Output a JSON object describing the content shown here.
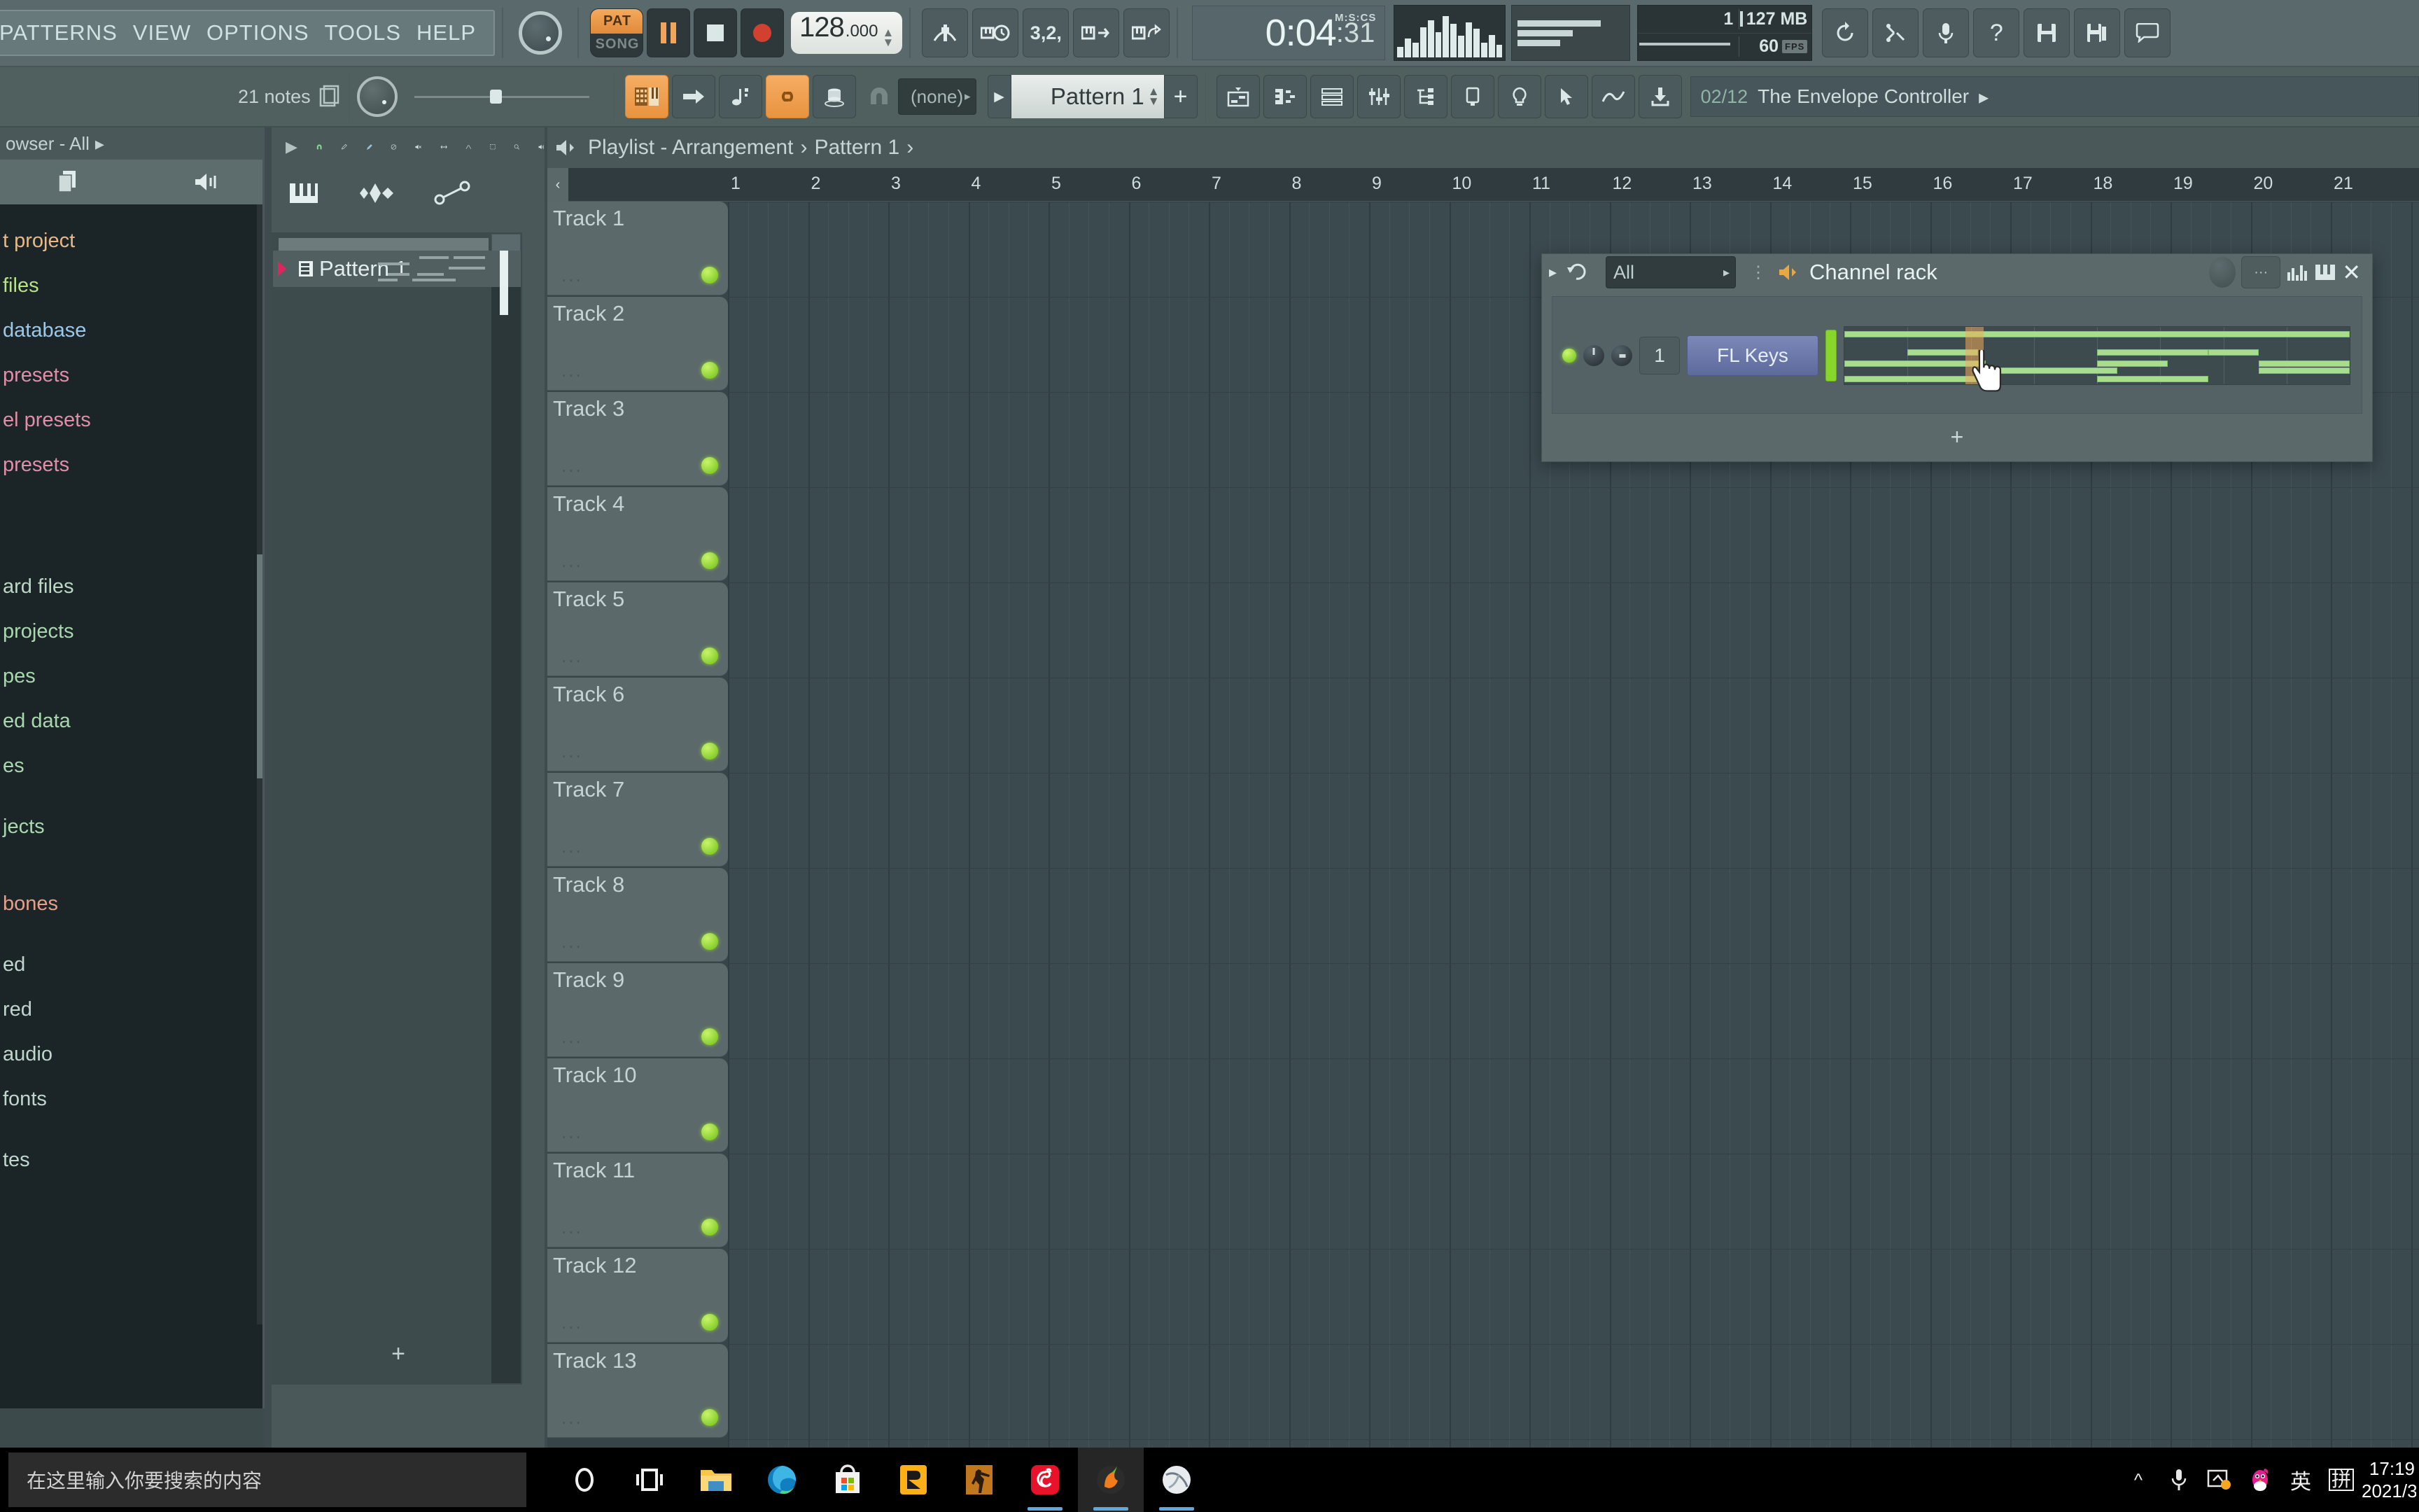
{
  "app": {
    "name": "FL Studio",
    "menu": [
      "PATTERNS",
      "VIEW",
      "OPTIONS",
      "TOOLS",
      "HELP"
    ]
  },
  "transport": {
    "pat_label": "PAT",
    "song_label": "SONG",
    "tempo_int": "128",
    "tempo_dec": ".000",
    "time_main": "0:04",
    "time_cs": ":31",
    "time_unit": "M:S:CS",
    "pause_icon": "pause-icon",
    "stop_icon": "stop-icon",
    "record_icon": "record-icon",
    "metronome_icon": "metronome-icon",
    "wait_icon": "wait-for-input-icon",
    "countdown_icon": "count-in-icon",
    "overlay_icon": "overlay-notes-icon",
    "loop_icon": "loop-record-icon"
  },
  "status": {
    "polyphony": "1",
    "memory": "127 MB",
    "fps": "60",
    "fps_label": "FPS"
  },
  "toolbar2": {
    "notes_count": "21 notes",
    "none_value": "(none)",
    "pattern_name": "Pattern 1",
    "plus_label": "+",
    "play_arrow": "▶",
    "buttons": [
      {
        "name": "step-sequencer-icon",
        "on": true
      },
      {
        "name": "arrow-right-icon",
        "on": false
      },
      {
        "name": "note-icon",
        "on": false
      },
      {
        "name": "link-icon",
        "on": true
      },
      {
        "name": "mixer-track-icon",
        "on": false
      }
    ],
    "right_buttons": [
      "playlist-icon",
      "piano-roll-icon",
      "channel-rack-icon",
      "mixer-icon",
      "browser-icon",
      "plugin-picker-icon",
      "tempo-tap-icon",
      "effects-icon",
      "online-content-icon"
    ]
  },
  "hint": {
    "number": "02/12",
    "text": "The Envelope Controller",
    "arrow": "▸"
  },
  "browser": {
    "title": "owser - All",
    "title_arrow": "▸",
    "items": [
      {
        "label": "t project",
        "color": "#e6b98a"
      },
      {
        "label": " files",
        "color": "#b9e08a"
      },
      {
        "label": "database",
        "color": "#9dc8e8"
      },
      {
        "label": "presets",
        "color": "#e08fa8"
      },
      {
        "label": "el presets",
        "color": "#e08fa8"
      },
      {
        "label": "presets",
        "color": "#e08fa8"
      },
      {
        "label": "",
        "color": "#b9e08a",
        "gap": true
      },
      {
        "label": "ard files",
        "color": "#bcd8c4"
      },
      {
        "label": "projects",
        "color": "#a9d8ae"
      },
      {
        "label": "pes",
        "color": "#a9d8ae"
      },
      {
        "label": "ed data",
        "color": "#a9d8ae"
      },
      {
        "label": "es",
        "color": "#a9d8ae"
      },
      {
        "label": "jects",
        "color": "#a9d8ae",
        "gap": true
      },
      {
        "label": " bones",
        "color": "#e4a08a",
        "gap": true
      },
      {
        "label": "ed",
        "color": "#c0d6cd"
      },
      {
        "label": "red",
        "color": "#c0d6cd"
      },
      {
        "label": "audio",
        "color": "#c0d6cd"
      },
      {
        "label": "fonts",
        "color": "#c0d6cd"
      },
      {
        "label": "tes",
        "color": "#c0d6cd",
        "gap": true
      },
      {
        "label": "",
        "color": "#c0d6cd"
      }
    ],
    "copy_icon": "copy-icon",
    "speaker_icon": "speaker-icon"
  },
  "picker": {
    "tools": [
      "play-icon",
      "magnet-icon",
      "draw-icon",
      "paint-icon",
      "mute-icon",
      "slip-icon",
      "slice-icon",
      "select-icon",
      "zoom-icon",
      "playback-icon"
    ],
    "tools2": [
      "piano-roll-icon",
      "audio-clip-icon",
      "automation-icon"
    ],
    "pattern_label": "Pattern 1",
    "plus": "+"
  },
  "playlist": {
    "breadcrumb_icon": "speaker-icon",
    "breadcrumb": "Playlist - Arrangement",
    "breadcrumb_sep": "›",
    "breadcrumb_current": "Pattern 1",
    "breadcrumb_end": "›",
    "ruler_marks": [
      "1",
      "2",
      "3",
      "4",
      "5",
      "6",
      "7",
      "8",
      "9",
      "10",
      "11",
      "12",
      "13",
      "14",
      "15",
      "16",
      "17",
      "18",
      "19",
      "20",
      "21"
    ],
    "left_arrow": "‹",
    "tracks": [
      "Track 1",
      "Track 2",
      "Track 3",
      "Track 4",
      "Track 5",
      "Track 6",
      "Track 7",
      "Track 8",
      "Track 9",
      "Track 10",
      "Track 11",
      "Track 12",
      "Track 13"
    ],
    "track_dots": "..."
  },
  "channel_rack": {
    "title": "Channel rack",
    "filter": "All",
    "filter_arrow": "▸",
    "menu_arrow": "▸",
    "undo_icon": "undo-icon",
    "grip_icon": "grip-icon",
    "speaker_icon": "speaker-icon",
    "graph_icon": "graph-editor-icon",
    "keyboard_icon": "keyboard-editor-icon",
    "close_icon": "close-icon",
    "channels": [
      {
        "index": "1",
        "name": "FL Keys",
        "led_on": true
      }
    ],
    "plus": "+"
  },
  "taskbar": {
    "search_placeholder": "在这里输入你要搜索的内容",
    "apps": [
      {
        "name": "cortana-icon",
        "state": ""
      },
      {
        "name": "task-view-icon",
        "state": ""
      },
      {
        "name": "file-explorer-icon",
        "state": ""
      },
      {
        "name": "microsoft-edge-icon",
        "state": ""
      },
      {
        "name": "microsoft-store-icon",
        "state": ""
      },
      {
        "name": "rockstar-games-icon",
        "state": ""
      },
      {
        "name": "csgo-icon",
        "state": ""
      },
      {
        "name": "netease-music-icon",
        "state": "running"
      },
      {
        "name": "fl-studio-icon",
        "state": "active"
      },
      {
        "name": "browser-app-icon",
        "state": "running"
      }
    ],
    "tray": [
      {
        "name": "show-hidden-icons-chevron",
        "glyph": "^"
      },
      {
        "name": "microphone-icon",
        "glyph": "mic"
      },
      {
        "name": "screenshot-icon",
        "glyph": "shot"
      },
      {
        "name": "qq-penguin-icon",
        "glyph": "qq"
      },
      {
        "name": "ime-english-icon",
        "glyph": "英"
      },
      {
        "name": "ime-pinyin-icon",
        "glyph": "拼"
      }
    ],
    "clock_time": "17:19",
    "clock_date": "2021/3"
  },
  "colors": {
    "accent_orange": "#f0a65c",
    "panel_bg": "#5a6a6c",
    "playlist_bg": "#3b4a4f",
    "note_green": "#a9dd8e",
    "browser_bg": "#1b2527"
  }
}
